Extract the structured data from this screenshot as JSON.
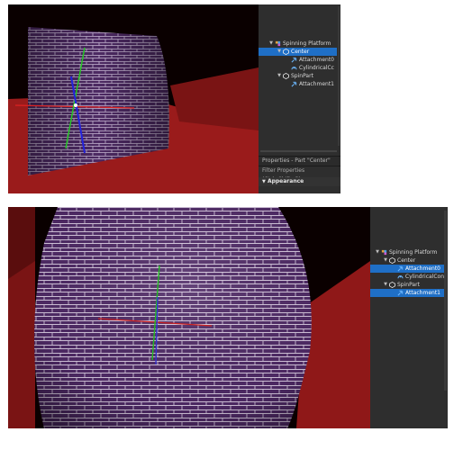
{
  "top": {
    "explorer": {
      "items": [
        {
          "label": "Spinning Platform",
          "level": 0,
          "icon": "model-icon"
        },
        {
          "label": "Center",
          "level": 1,
          "icon": "part-icon",
          "selected": true
        },
        {
          "label": "Attachment0",
          "level": 2,
          "icon": "attachment-icon"
        },
        {
          "label": "CylindricalCc",
          "level": 2,
          "icon": "constraint-icon"
        },
        {
          "label": "SpinPart",
          "level": 1,
          "icon": "part-icon"
        },
        {
          "label": "Attachment1",
          "level": 2,
          "icon": "attachment-icon"
        }
      ]
    },
    "properties": {
      "title": "Properties - Part \"Center\"",
      "filter": "Filter Properties (Ctrl+Shift+P)",
      "section": "Appearance"
    }
  },
  "bottom": {
    "explorer": {
      "items": [
        {
          "label": "Spinning Platform",
          "level": 0,
          "icon": "model-icon"
        },
        {
          "label": "Center",
          "level": 1,
          "icon": "part-icon"
        },
        {
          "label": "Attachment0",
          "level": 2,
          "icon": "attachment-icon",
          "selected": true
        },
        {
          "label": "CylindricalCon",
          "level": 2,
          "icon": "constraint-icon"
        },
        {
          "label": "SpinPart",
          "level": 1,
          "icon": "part-icon"
        },
        {
          "label": "Attachment1",
          "level": 2,
          "icon": "attachment-icon",
          "selected": true
        }
      ]
    }
  },
  "colors": {
    "selection": "#1f6fc6",
    "floor": "#a31d1d",
    "panel": "#2e2e2e",
    "brick": "#5a2e6e"
  }
}
